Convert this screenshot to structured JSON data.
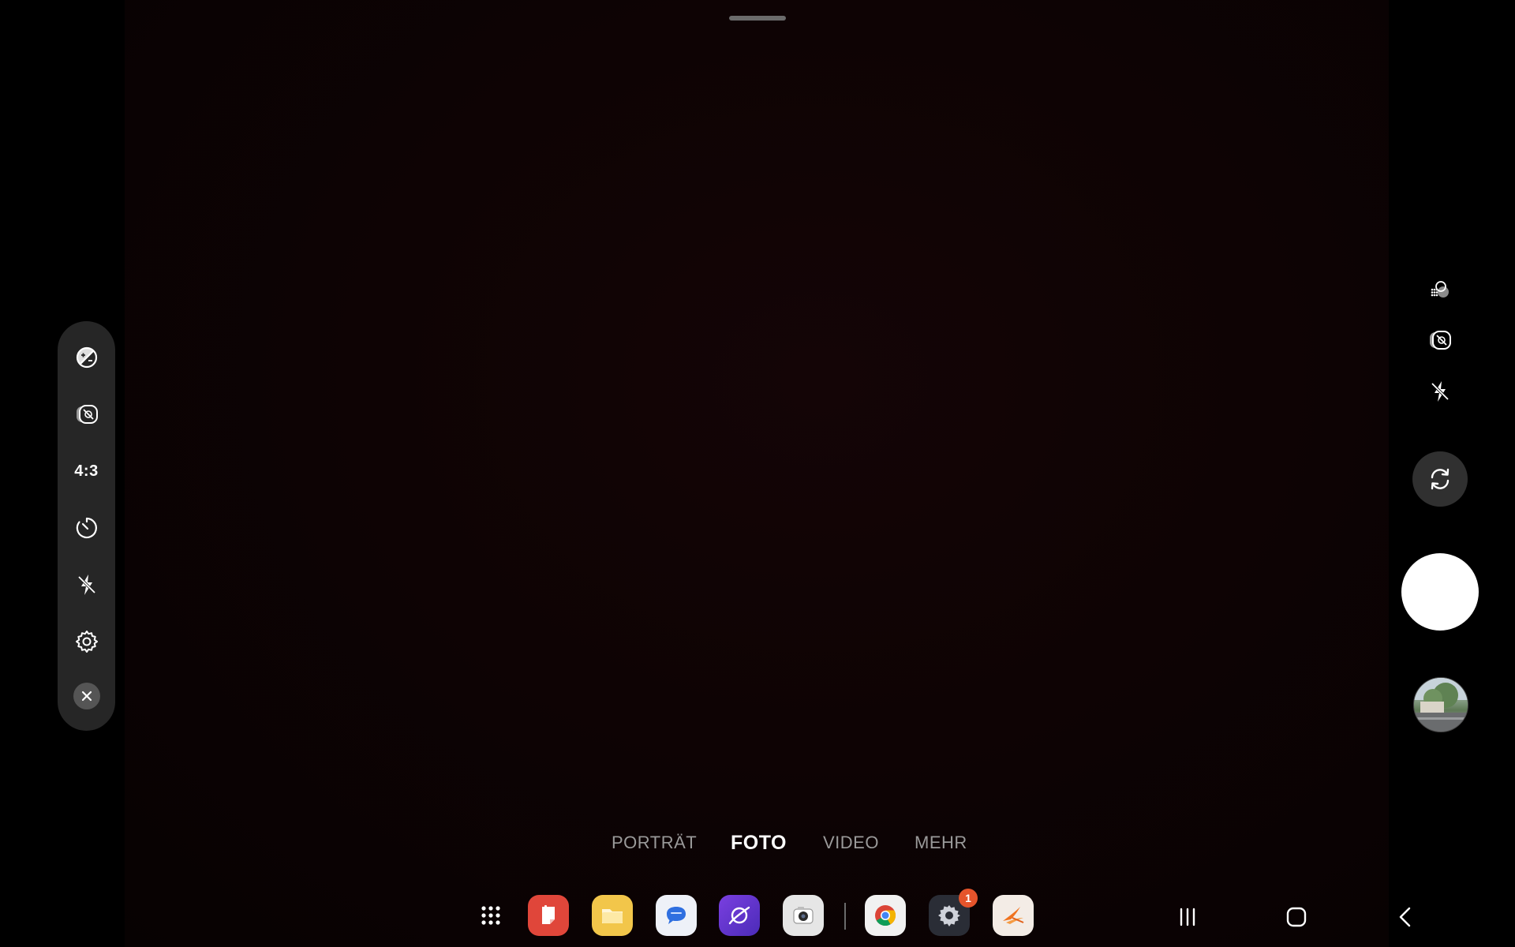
{
  "left_panel": {
    "ratio_label": "4:3",
    "icons": [
      "exposure-icon",
      "motion-photo-icon",
      "aspect-ratio",
      "timer-icon",
      "flash-off-icon",
      "settings-icon",
      "close-icon"
    ]
  },
  "right_panel": {
    "icons": [
      "filters-icon",
      "motion-photo-off-icon",
      "flash-off-icon",
      "switch-camera-icon",
      "shutter",
      "gallery-thumbnail"
    ]
  },
  "modes": [
    {
      "label": "PORTRÄT",
      "active": false
    },
    {
      "label": "FOTO",
      "active": true
    },
    {
      "label": "VIDEO",
      "active": false
    },
    {
      "label": "MEHR",
      "active": false
    }
  ],
  "taskbar": {
    "apps": [
      "app-drawer",
      "notes",
      "files",
      "messages",
      "internet",
      "camera",
      "chrome",
      "settings",
      "other-app"
    ],
    "settings_badge": "1"
  },
  "nav": [
    "recents-icon",
    "home-icon",
    "back-icon"
  ],
  "colors": {
    "panel_bg": "#262626",
    "badge": "#e5542b",
    "mode_inactive": "#9a9a9a",
    "mode_active": "#ffffff"
  }
}
